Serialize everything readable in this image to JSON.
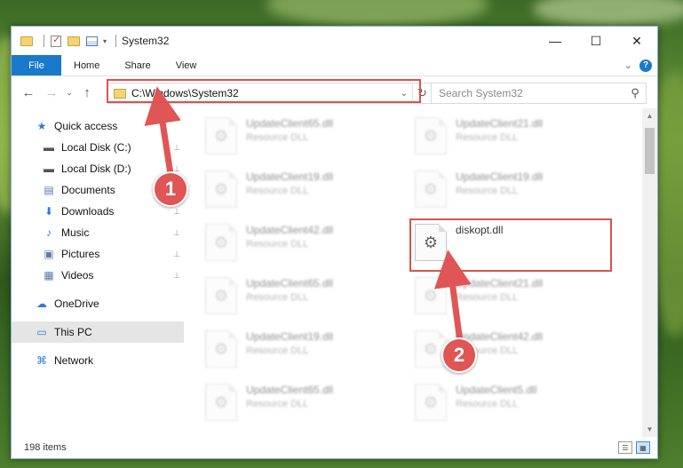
{
  "window": {
    "title": "System32",
    "controls": [
      "minimize-icon",
      "maximize-icon",
      "close-icon"
    ]
  },
  "ribbon": {
    "tabs": [
      "File",
      "Home",
      "Share",
      "View"
    ],
    "help_label": "?"
  },
  "navigation": {
    "address": "C:\\Windows\\System32",
    "search_placeholder": "Search System32"
  },
  "sidebar": {
    "items": [
      {
        "label": "Quick access",
        "icon": "star-icon",
        "pinned": false
      },
      {
        "label": "Local Disk (C:)",
        "icon": "drive-icon",
        "pinned": true
      },
      {
        "label": "Local Disk (D:)",
        "icon": "drive-icon",
        "pinned": true
      },
      {
        "label": "Documents",
        "icon": "documents-icon",
        "pinned": true
      },
      {
        "label": "Downloads",
        "icon": "downloads-icon",
        "pinned": true
      },
      {
        "label": "Music",
        "icon": "music-icon",
        "pinned": true
      },
      {
        "label": "Pictures",
        "icon": "pictures-icon",
        "pinned": true
      },
      {
        "label": "Videos",
        "icon": "videos-icon",
        "pinned": true
      },
      {
        "label": "OneDrive",
        "icon": "cloud-icon",
        "pinned": false
      },
      {
        "label": "This PC",
        "icon": "computer-icon",
        "pinned": false,
        "selected": true
      },
      {
        "label": "Network",
        "icon": "network-icon",
        "pinned": false
      }
    ]
  },
  "files": [
    {
      "name": "UpdateClient65.dll",
      "type": "Resource DLL"
    },
    {
      "name": "UpdateClient21.dll",
      "type": "Resource DLL"
    },
    {
      "name": "UpdateClient19.dll",
      "type": "Resource DLL"
    },
    {
      "name": "UpdateClient19.dll",
      "type": "Resource DLL"
    },
    {
      "name": "UpdateClient42.dll",
      "type": "Resource DLL"
    },
    {
      "name": "diskopt.dll",
      "type": "",
      "highlighted": true
    },
    {
      "name": "UpdateClient65.dll",
      "type": "Resource DLL"
    },
    {
      "name": "UpdateClient21.dll",
      "type": "Resource DLL"
    },
    {
      "name": "UpdateClient19.dll",
      "type": "Resource DLL"
    },
    {
      "name": "UpdateClient42.dll",
      "type": "Resource DLL"
    },
    {
      "name": "UpdateClient65.dll",
      "type": "Resource DLL"
    },
    {
      "name": "UpdateClient5.dll",
      "type": "Resource DLL"
    }
  ],
  "status": {
    "item_count": "198 items"
  },
  "annotations": {
    "step1": "1",
    "step2": "2",
    "color": "#e05555"
  }
}
